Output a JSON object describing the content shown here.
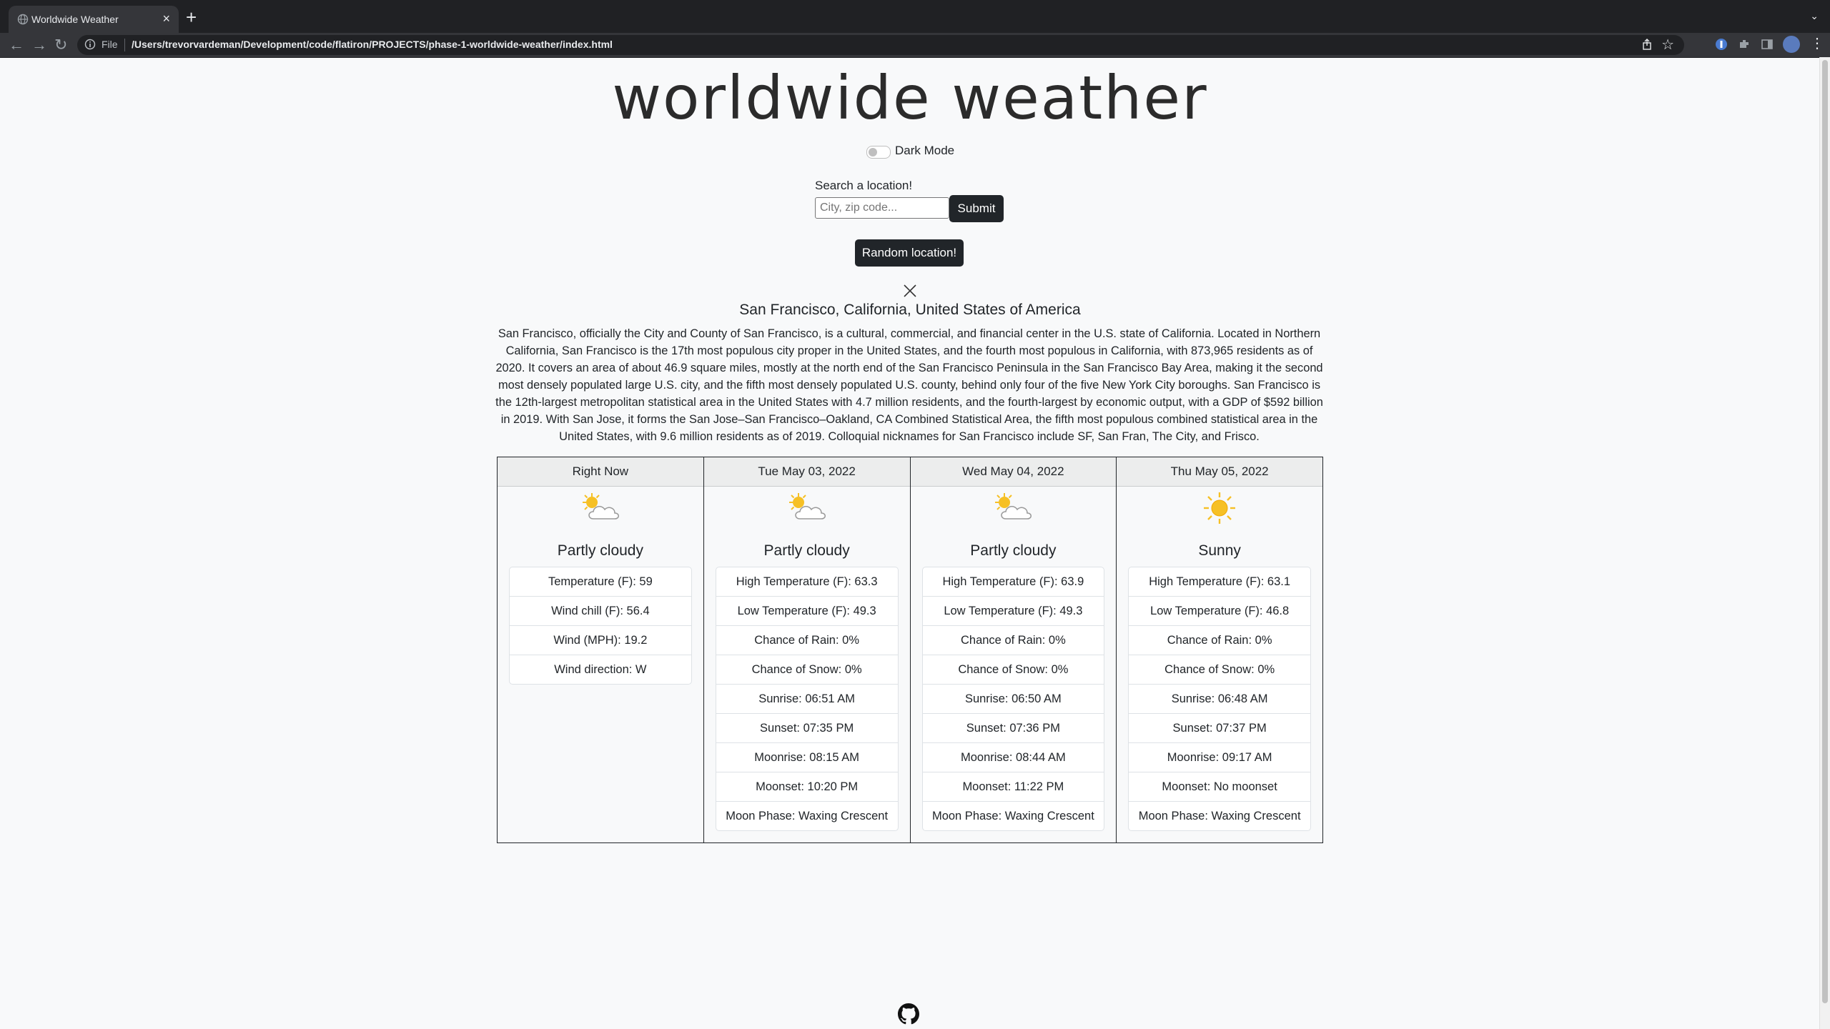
{
  "browser": {
    "tab_title": "Worldwide Weather",
    "tab_close": "×",
    "new_tab": "+",
    "file_label": "File",
    "url": "/Users/trevorvardeman/Development/code/flatiron/PROJECTS/phase-1-worldwide-weather/index.html",
    "icons": [
      "back-arrow-icon",
      "forward-arrow-icon",
      "reload-icon",
      "info-icon",
      "share-icon",
      "star-icon",
      "extension-icon",
      "puzzle-icon",
      "sidebar-icon",
      "profile-avatar",
      "menu-icon"
    ]
  },
  "header": {
    "title": "worldwide weather",
    "dark_mode_label": "Dark Mode",
    "dark_mode_on": false
  },
  "search": {
    "label": "Search a location!",
    "placeholder": "City, zip code...",
    "value": "",
    "submit_label": "Submit",
    "random_label": "Random location!"
  },
  "location": {
    "name": "San Francisco, California, United States of America",
    "description": "San Francisco, officially the City and County of San Francisco, is a cultural, commercial, and financial center in the U.S. state of California. Located in Northern California, San Francisco is the 17th most populous city proper in the United States, and the fourth most populous in California, with 873,965 residents as of 2020. It covers an area of about 46.9 square miles, mostly at the north end of the San Francisco Peninsula in the San Francisco Bay Area, making it the second most densely populated large U.S. city, and the fifth most densely populated U.S. county, behind only four of the five New York City boroughs. San Francisco is the 12th-largest metropolitan statistical area in the United States with 4.7 million residents, and the fourth-largest by economic output, with a GDP of $592 billion in 2019. With San Jose, it forms the San Jose–San Francisco–Oakland, CA Combined Statistical Area, the fifth most populous combined statistical area in the United States, with 9.6 million residents as of 2019. Colloquial nicknames for San Francisco include SF, San Fran, The City, and Frisco."
  },
  "forecast": [
    {
      "header": "Right Now",
      "icon": "partly-cloudy-icon",
      "condition": "Partly cloudy",
      "items": [
        "Temperature (F): 59",
        "Wind chill (F): 56.4",
        "Wind (MPH): 19.2",
        "Wind direction: W"
      ]
    },
    {
      "header": "Tue May 03, 2022",
      "icon": "partly-cloudy-icon",
      "condition": "Partly cloudy",
      "items": [
        "High Temperature (F): 63.3",
        "Low Temperature (F): 49.3",
        "Chance of Rain: 0%",
        "Chance of Snow: 0%",
        "Sunrise: 06:51 AM",
        "Sunset: 07:35 PM",
        "Moonrise: 08:15 AM",
        "Moonset: 10:20 PM",
        "Moon Phase: Waxing Crescent"
      ]
    },
    {
      "header": "Wed May 04, 2022",
      "icon": "partly-cloudy-icon",
      "condition": "Partly cloudy",
      "items": [
        "High Temperature (F): 63.9",
        "Low Temperature (F): 49.3",
        "Chance of Rain: 0%",
        "Chance of Snow: 0%",
        "Sunrise: 06:50 AM",
        "Sunset: 07:36 PM",
        "Moonrise: 08:44 AM",
        "Moonset: 11:22 PM",
        "Moon Phase: Waxing Crescent"
      ]
    },
    {
      "header": "Thu May 05, 2022",
      "icon": "sunny-icon",
      "condition": "Sunny",
      "items": [
        "High Temperature (F): 63.1",
        "Low Temperature (F): 46.8",
        "Chance of Rain: 0%",
        "Chance of Snow: 0%",
        "Sunrise: 06:48 AM",
        "Sunset: 07:37 PM",
        "Moonrise: 09:17 AM",
        "Moonset: No moonset",
        "Moon Phase: Waxing Crescent"
      ]
    }
  ],
  "footer": {
    "icon": "github-icon"
  },
  "colors": {
    "page_bg": "#f8f9fa",
    "button_dark": "#212529",
    "sun": "#f6c025",
    "cloud_stroke": "#9a9a9a"
  }
}
